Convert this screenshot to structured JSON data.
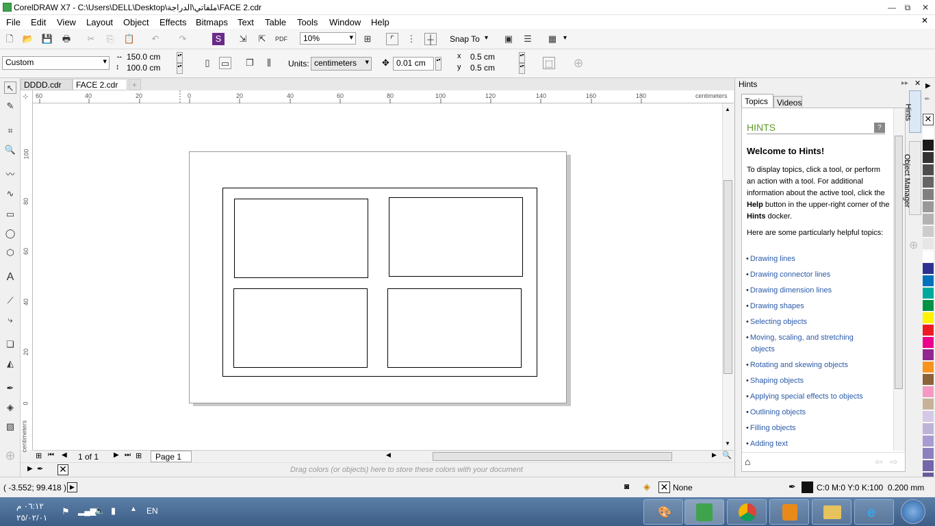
{
  "window": {
    "title": "CorelDRAW X7 - C:\\Users\\DELL\\Desktop\\ملفاتي\\الدراجة\\FACE 2.cdr",
    "minimize": "—",
    "restore": "⧉",
    "close": "✕"
  },
  "menu": [
    "File",
    "Edit",
    "View",
    "Layout",
    "Object",
    "Effects",
    "Bitmaps",
    "Text",
    "Table",
    "Tools",
    "Window",
    "Help"
  ],
  "std": {
    "zoom": "10%",
    "snap_to": "Snap To"
  },
  "prop": {
    "preset": "Custom",
    "width": "150.0 cm",
    "height": "100.0 cm",
    "units_label": "Units:",
    "units": "centimeters",
    "nudge": "0.01 cm",
    "dup_x": "0.5 cm",
    "dup_y": "0.5 cm",
    "x_label": "x",
    "y_label": "y"
  },
  "tabs": [
    "DDDD.cdr",
    "FACE 2.cdr",
    "+"
  ],
  "ruler": {
    "h_ticks": [
      "60",
      "40",
      "20",
      "0",
      "20",
      "40",
      "60",
      "80",
      "100",
      "120",
      "140",
      "160",
      "180"
    ],
    "h_unit": "centimeters",
    "v_ticks": [
      "100",
      "80",
      "60",
      "40",
      "20",
      "0"
    ],
    "v_unit": "centimeters"
  },
  "pagebar": {
    "page_count": "1 of 1",
    "page_name": "Page 1"
  },
  "colorwell": {
    "hint": "Drag colors (or objects) here to store these colors with your document"
  },
  "docker": {
    "title": "Hints",
    "tab_topics": "Topics",
    "tab_videos": "Videos",
    "heading": "HINTS",
    "welcome": "Welcome to Hints!",
    "para1_a": "To display topics, click a tool, or perform an action with a tool. For additional information about the active tool, click the ",
    "para1_help": "Help",
    "para1_b": " button in the upper-right corner of the ",
    "para1_hints": "Hints",
    "para1_c": " docker.",
    "para2": "Here are some particularly helpful topics:",
    "links": [
      "Drawing lines",
      "Drawing connector lines",
      "Drawing dimension lines",
      "Drawing shapes",
      "Selecting objects",
      "Moving, scaling, and stretching",
      "objects",
      "Rotating and skewing objects",
      "Shaping objects",
      "Applying special effects to objects",
      "Outlining objects",
      "Filling objects",
      "Adding text"
    ],
    "side_tab_hints": "Hints",
    "side_tab_objmgr": "Object Manager"
  },
  "palette": [
    "#ffffff",
    "#1a1a1a",
    "#333333",
    "#4d4d4d",
    "#666666",
    "#808080",
    "#999999",
    "#b3b3b3",
    "#cccccc",
    "#e6e6e6",
    "#ffffff",
    "#2e3192",
    "#0071bc",
    "#00a99d",
    "#009245",
    "#fff200",
    "#ed1c24",
    "#ec008c",
    "#92278f",
    "#f7941d",
    "#8c6239",
    "#f49ac2",
    "#c7b299",
    "#d4c8e6",
    "#bdb3d9",
    "#a99bd1",
    "#8c7fc0",
    "#7365a8",
    "#665c99",
    "#4d4580",
    "#3a3466"
  ],
  "status": {
    "coords": "( -3.552; 99.418 )",
    "fill": "None",
    "outline": "C:0 M:0 Y:0 K:100  0.200 mm"
  },
  "taskbar": {
    "time": "٠٦:١٢ م",
    "date": "٢٥/٠٢/٠١",
    "lang": "EN"
  }
}
